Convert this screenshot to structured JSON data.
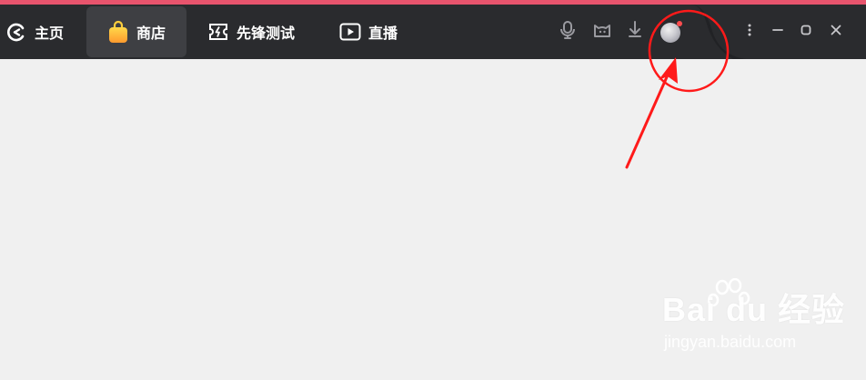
{
  "tabs": [
    {
      "label": "主页",
      "icon": "home-c-icon"
    },
    {
      "label": "商店",
      "icon": "shopping-bag-icon",
      "active": true
    },
    {
      "label": "先锋测试",
      "icon": "test-ticket-icon"
    },
    {
      "label": "直播",
      "icon": "play-icon"
    }
  ],
  "toolbar_icons": [
    "microphone-icon",
    "cat-face-icon",
    "download-icon",
    "avatar-icon"
  ],
  "window_controls": [
    "more-icon",
    "minimize-icon",
    "maximize-icon",
    "close-icon"
  ],
  "notification": {
    "has_unread": true
  },
  "watermark": {
    "main": "Bai du 经验",
    "sub": "jingyan.baidu.com"
  },
  "colors": {
    "accent_line": "#e8546d",
    "titlebar": "#2a2b2e",
    "active_tab": "#3e3f43",
    "annotation": "#ff1a1a",
    "content_bg": "#f0f0f0"
  }
}
